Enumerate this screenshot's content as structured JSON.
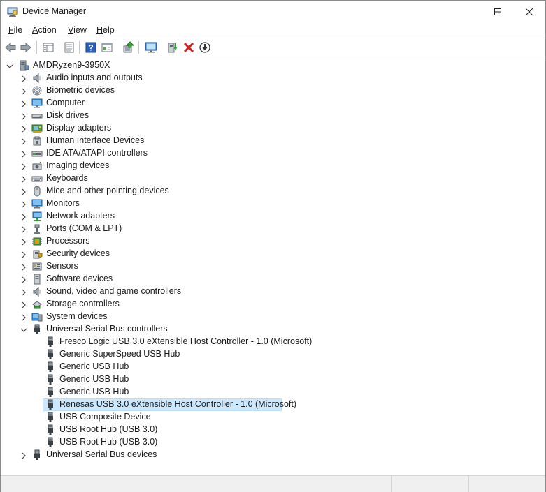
{
  "window": {
    "title": "Device Manager",
    "app_icon": "device-manager-icon"
  },
  "title_buttons": [
    {
      "name": "minimize-button",
      "icon": "minimize-icon"
    },
    {
      "name": "maximize-button",
      "icon": "maximize-icon"
    },
    {
      "name": "close-button",
      "icon": "close-icon"
    }
  ],
  "menu": {
    "items": [
      {
        "id": "file",
        "accel": "F",
        "rest": "ile"
      },
      {
        "id": "action",
        "accel": "A",
        "rest": "ction"
      },
      {
        "id": "view",
        "accel": "V",
        "rest": "iew"
      },
      {
        "id": "help",
        "accel": "H",
        "rest": "elp"
      }
    ]
  },
  "toolbar": {
    "buttons": [
      "back-icon",
      "forward-icon",
      "properties-grid-icon",
      "properties-icon",
      "help-icon",
      "show-hidden-icon",
      "update-driver-icon",
      "scan-hardware-icon",
      "enable-device-icon",
      "uninstall-icon",
      "disable-icon"
    ]
  },
  "tree": {
    "root": {
      "label": "AMDRyzen9-3950X",
      "icon": "computer-icon",
      "expanded": true
    },
    "categories": [
      {
        "label": "Audio inputs and outputs",
        "icon": "speaker-icon",
        "expanded": false
      },
      {
        "label": "Biometric devices",
        "icon": "fingerprint-icon",
        "expanded": false
      },
      {
        "label": "Computer",
        "icon": "monitor-icon",
        "expanded": false
      },
      {
        "label": "Disk drives",
        "icon": "disk-drive-icon",
        "expanded": false
      },
      {
        "label": "Display adapters",
        "icon": "display-adapter-icon",
        "expanded": false
      },
      {
        "label": "Human Interface Devices",
        "icon": "hid-icon",
        "expanded": false
      },
      {
        "label": "IDE ATA/ATAPI controllers",
        "icon": "ide-controller-icon",
        "expanded": false
      },
      {
        "label": "Imaging devices",
        "icon": "camera-icon",
        "expanded": false
      },
      {
        "label": "Keyboards",
        "icon": "keyboard-icon",
        "expanded": false
      },
      {
        "label": "Mice and other pointing devices",
        "icon": "mouse-icon",
        "expanded": false
      },
      {
        "label": "Monitors",
        "icon": "monitor-icon",
        "expanded": false
      },
      {
        "label": "Network adapters",
        "icon": "network-icon",
        "expanded": false
      },
      {
        "label": "Ports (COM & LPT)",
        "icon": "port-icon",
        "expanded": false
      },
      {
        "label": "Processors",
        "icon": "processor-icon",
        "expanded": false
      },
      {
        "label": "Security devices",
        "icon": "security-icon",
        "expanded": false
      },
      {
        "label": "Sensors",
        "icon": "sensor-icon",
        "expanded": false
      },
      {
        "label": "Software devices",
        "icon": "software-icon",
        "expanded": false
      },
      {
        "label": "Sound, video and game controllers",
        "icon": "speaker-icon",
        "expanded": false
      },
      {
        "label": "Storage controllers",
        "icon": "storage-icon",
        "expanded": false
      },
      {
        "label": "System devices",
        "icon": "system-icon",
        "expanded": false
      },
      {
        "label": "Universal Serial Bus controllers",
        "icon": "usb-icon",
        "expanded": true,
        "children": [
          {
            "label": "Fresco Logic USB 3.0 eXtensible Host Controller - 1.0 (Microsoft)",
            "icon": "usb-icon",
            "selected": false
          },
          {
            "label": "Generic SuperSpeed USB Hub",
            "icon": "usb-icon",
            "selected": false
          },
          {
            "label": "Generic USB Hub",
            "icon": "usb-icon",
            "selected": false
          },
          {
            "label": "Generic USB Hub",
            "icon": "usb-icon",
            "selected": false
          },
          {
            "label": "Generic USB Hub",
            "icon": "usb-icon",
            "selected": false
          },
          {
            "label": "Renesas USB 3.0 eXtensible Host Controller - 1.0 (Microsoft)",
            "icon": "usb-icon",
            "selected": true
          },
          {
            "label": "USB Composite Device",
            "icon": "usb-icon",
            "selected": false
          },
          {
            "label": "USB Root Hub (USB 3.0)",
            "icon": "usb-icon",
            "selected": false
          },
          {
            "label": "USB Root Hub (USB 3.0)",
            "icon": "usb-icon",
            "selected": false
          }
        ]
      },
      {
        "label": "Universal Serial Bus devices",
        "icon": "usb-icon",
        "expanded": false
      }
    ]
  },
  "colors": {
    "selection": "#cce8ff",
    "selection_border": "#b9dcf8",
    "accent": "#0a64c8"
  }
}
